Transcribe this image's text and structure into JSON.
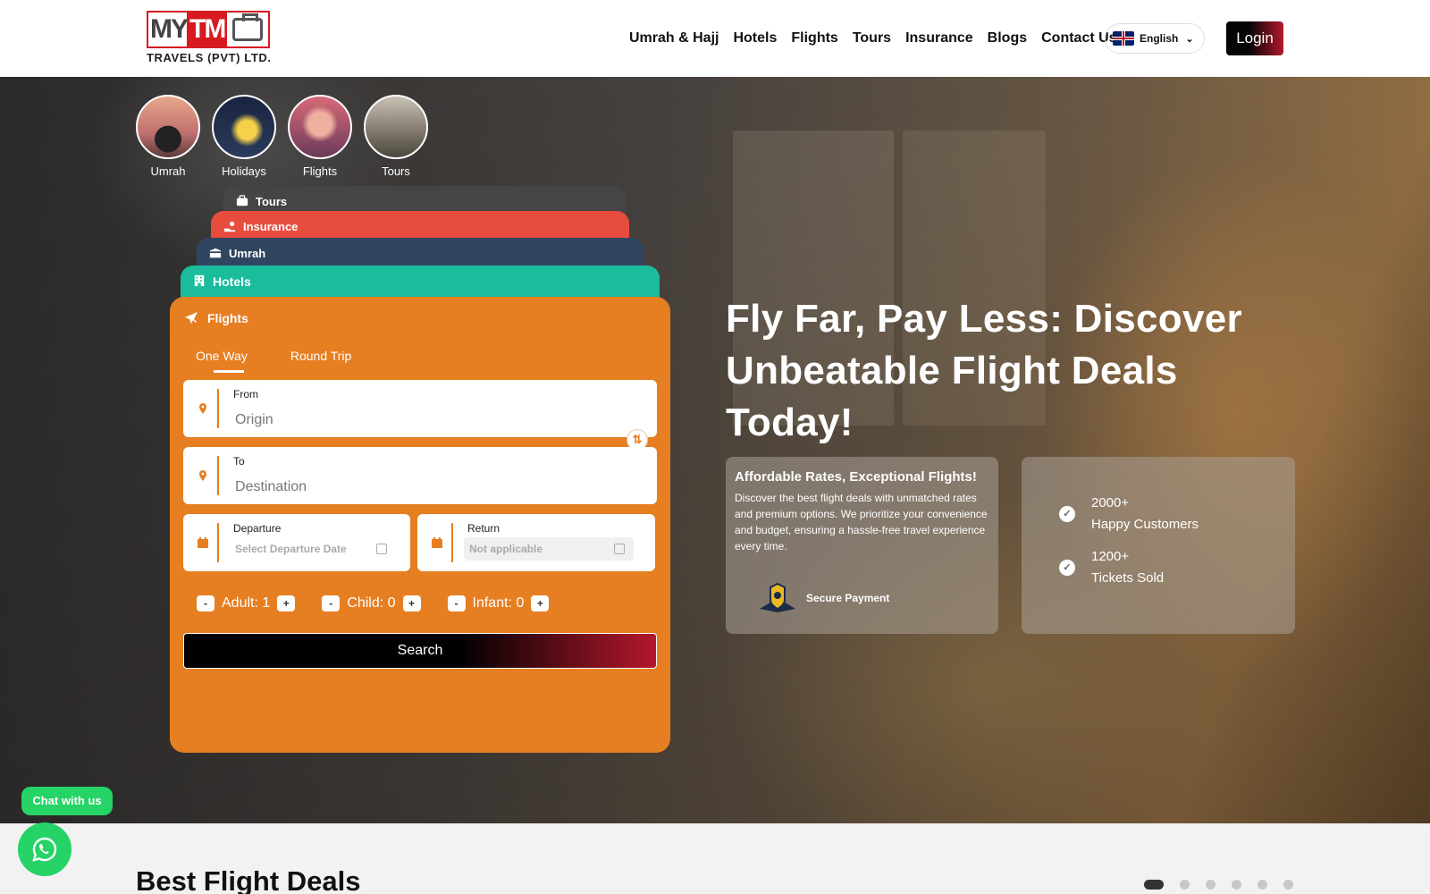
{
  "header": {
    "logo_text": "MY TM TRAVELS (PVT) LTD.",
    "logo_sub": "TRAVELS (PVT) LTD.",
    "nav": [
      "Umrah & Hajj",
      "Hotels",
      "Flights",
      "Tours",
      "Insurance",
      "Blogs",
      "Contact Us"
    ],
    "language": "English",
    "login": "Login"
  },
  "categories": [
    {
      "label": "Umrah"
    },
    {
      "label": "Holidays"
    },
    {
      "label": "Flights"
    },
    {
      "label": "Tours"
    }
  ],
  "tabs": {
    "tours": "Tours",
    "insurance": "Insurance",
    "umrah": "Umrah",
    "hotels": "Hotels",
    "flights": "Flights"
  },
  "search_form": {
    "trip_types": [
      "One Way",
      "Round Trip"
    ],
    "selected_trip": "One Way",
    "from_label": "From",
    "from_placeholder": "Origin",
    "to_label": "To",
    "to_placeholder": "Destination",
    "departure_label": "Departure",
    "departure_placeholder": "Select Departure Date",
    "return_label": "Return",
    "return_placeholder": "Not applicable",
    "adult": "Adult: 1",
    "child": "Child: 0",
    "infant": "Infant: 0",
    "search_button": "Search"
  },
  "hero": {
    "headline": "Fly Far, Pay Less: Discover Unbeatable Flight Deals Today!",
    "card_title": "Affordable Rates, Exceptional Flights!",
    "card_text": "Discover the best flight deals with unmatched rates and premium options. We prioritize your convenience and budget, ensuring a hassle-free travel experience every time.",
    "secure_payment": "Secure Payment",
    "stat1_value": "2000+",
    "stat1_label": "Happy Customers",
    "stat2_value": "1200+",
    "stat2_label": "Tickets Sold"
  },
  "chat": {
    "label": "Chat with us"
  },
  "section": {
    "title": "Best Flight Deals"
  },
  "carousel": {
    "total_dots": 6,
    "active_dot": 1
  },
  "colors": {
    "accent_orange": "#e67e22",
    "brand_red": "#d71920",
    "hotels_tab": "#1abc9c",
    "umrah_tab": "#2f4560",
    "insurance_tab": "#e84c3d",
    "tours_tab": "#454545",
    "whatsapp": "#25d366"
  }
}
